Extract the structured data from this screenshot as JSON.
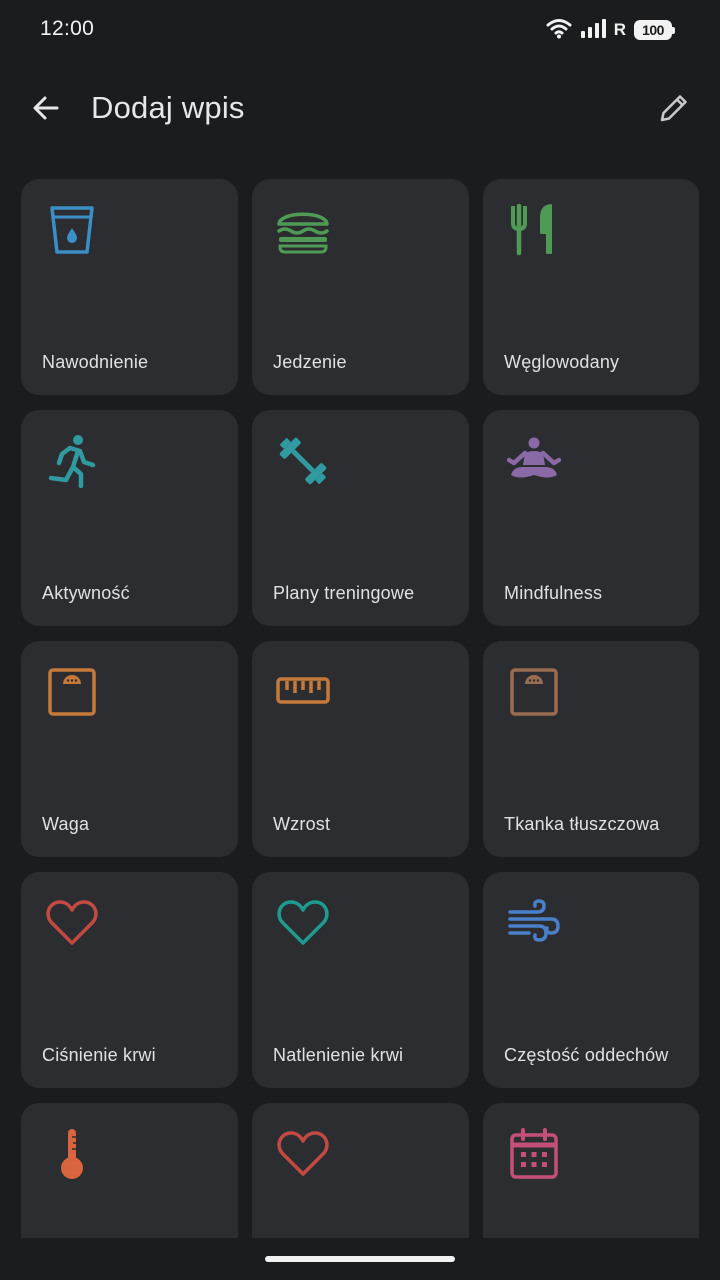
{
  "status": {
    "time": "12:00",
    "network": "R",
    "battery": "100",
    "icons": [
      "wifi-icon",
      "cellular-signal-icon",
      "battery-icon"
    ]
  },
  "header": {
    "title": "Dodaj wpis",
    "back_icon": "arrow-left-icon",
    "edit_icon": "pencil-icon"
  },
  "tiles": [
    {
      "label": "Nawodnienie",
      "icon": "water-glass-icon",
      "color": "#3a8fc6"
    },
    {
      "label": "Jedzenie",
      "icon": "burger-icon",
      "color": "#4f9a55"
    },
    {
      "label": "Węglowodany",
      "icon": "fork-knife-icon",
      "color": "#4f9a55"
    },
    {
      "label": "Aktywność",
      "icon": "running-person-icon",
      "color": "#2f9aa0"
    },
    {
      "label": "Plany treningowe",
      "icon": "dumbbell-icon",
      "color": "#2f9aa0"
    },
    {
      "label": "Mindfulness",
      "icon": "meditation-icon",
      "color": "#8a6aa6"
    },
    {
      "label": "Waga",
      "icon": "scale-icon",
      "color": "#c5793a"
    },
    {
      "label": "Wzrost",
      "icon": "ruler-icon",
      "color": "#c5793a"
    },
    {
      "label": "Tkanka tłuszczowa",
      "icon": "scale-icon",
      "color": "#9a6c52"
    },
    {
      "label": "Ciśnienie krwi",
      "icon": "heart-icon",
      "color": "#c24a42"
    },
    {
      "label": "Natlenienie krwi",
      "icon": "heart-icon",
      "color": "#1e9b90"
    },
    {
      "label": "Częstość oddechów",
      "icon": "wind-icon",
      "color": "#4a7fc9"
    },
    {
      "label": "",
      "icon": "thermometer-icon",
      "color": "#d9653f"
    },
    {
      "label": "",
      "icon": "heart-icon",
      "color": "#c24a42"
    },
    {
      "label": "",
      "icon": "calendar-icon",
      "color": "#c4507a"
    }
  ]
}
